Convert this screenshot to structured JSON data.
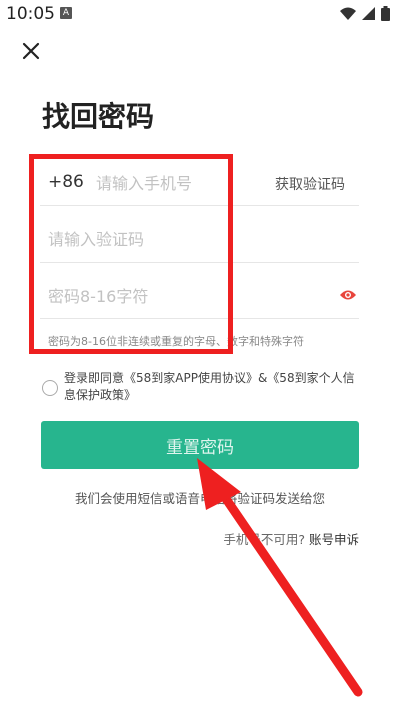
{
  "status_bar": {
    "time": "10:05",
    "notification_icon_letter": "A",
    "icons": [
      "wifi-icon",
      "signal-icon",
      "battery-icon"
    ]
  },
  "page": {
    "title": "找回密码"
  },
  "phone_row": {
    "country_code": "+86",
    "placeholder": "请输入手机号",
    "get_code_label": "获取验证码"
  },
  "code_row": {
    "placeholder": "请输入验证码"
  },
  "password_row": {
    "placeholder": "密码8-16字符",
    "hint": "密码为8-16位非连续或重复的字母、数字和特殊字符"
  },
  "agreement": {
    "text": "登录即同意《58到家APP使用协议》&《58到家个人信息保护政策》"
  },
  "reset_button_label": "重置密码",
  "sms_note": "我们会使用短信或语音电话将验证码发送给您",
  "unavailable": {
    "text": "手机号不可用?",
    "appeal_label": "账号申诉"
  },
  "colors": {
    "accent": "#27b58e",
    "annotation": "#ee2020",
    "eye_icon": "#e8453c"
  }
}
